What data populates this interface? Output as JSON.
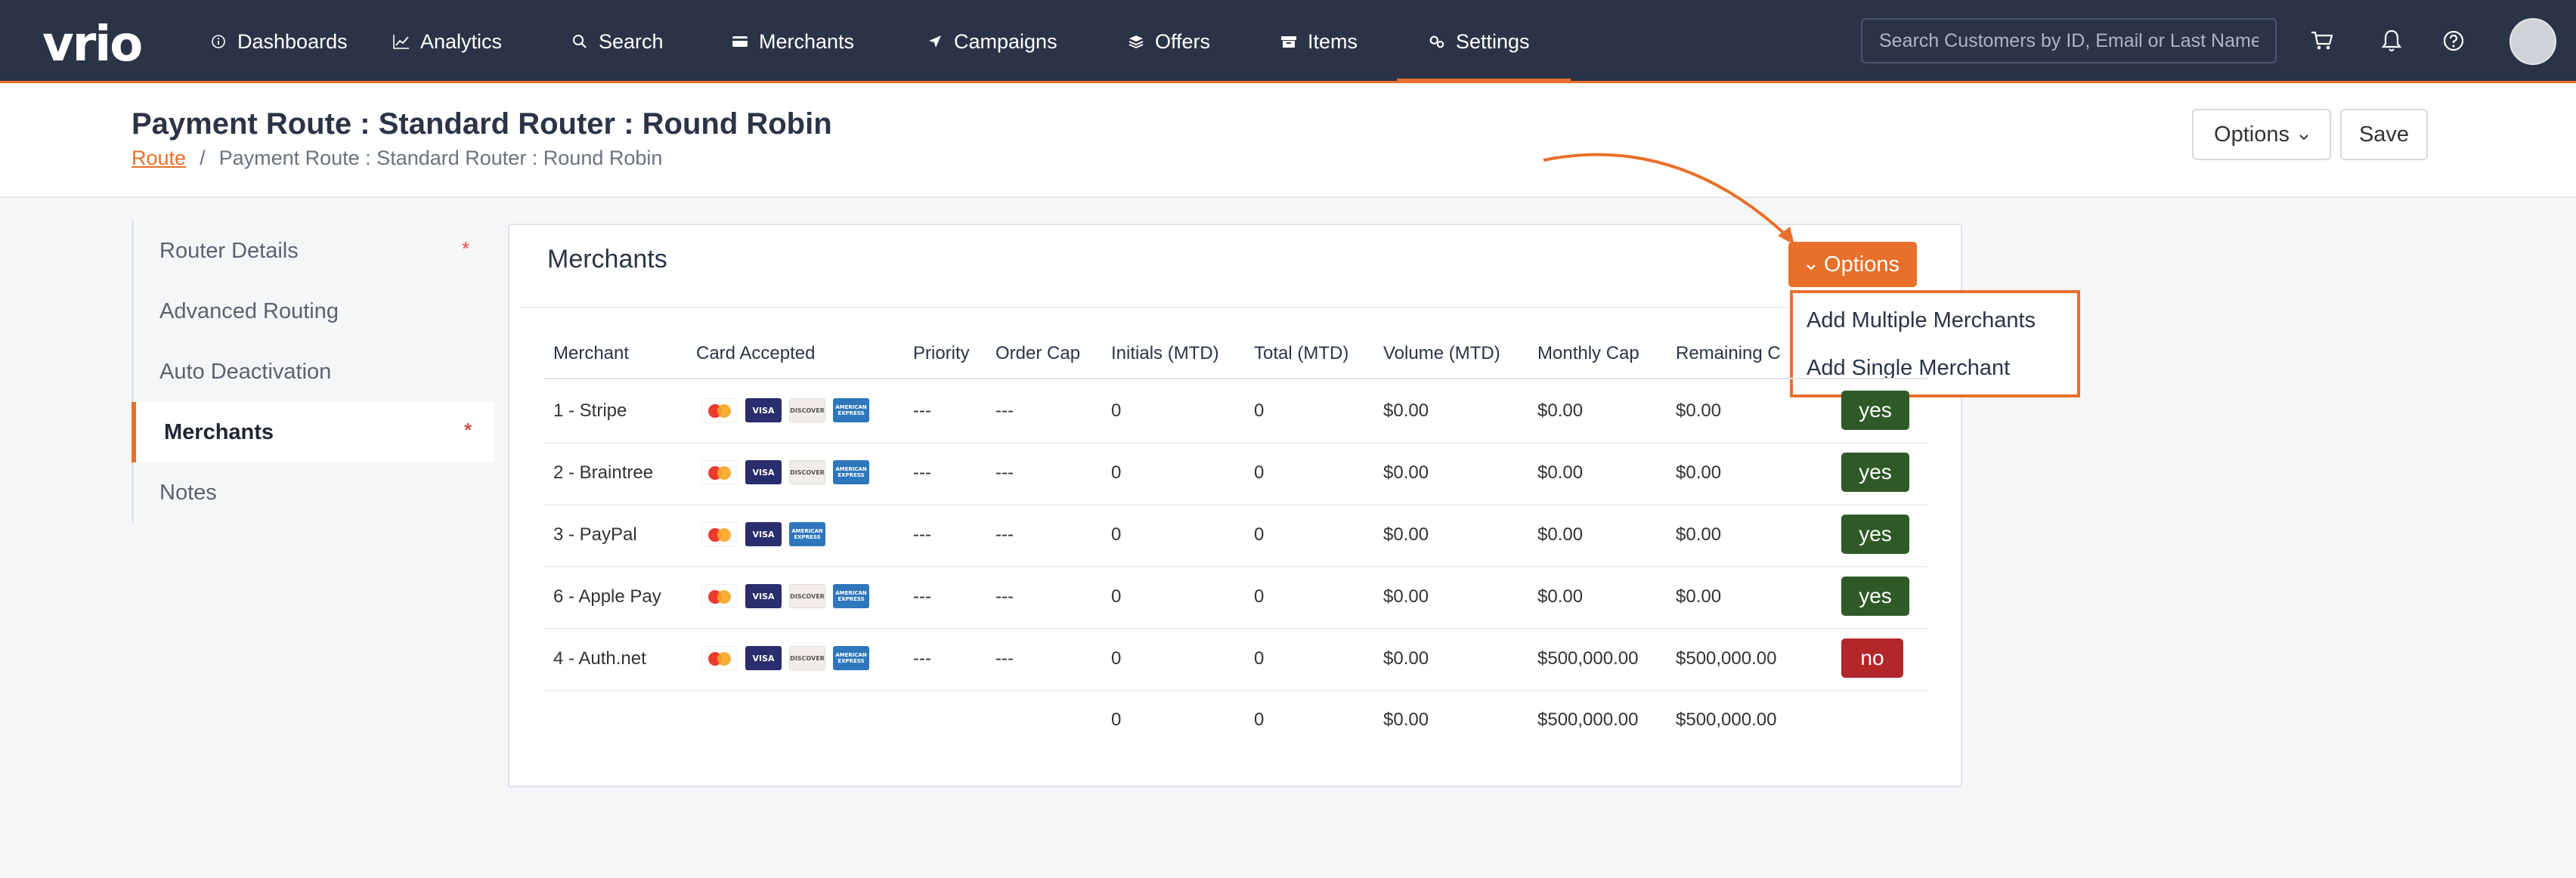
{
  "nav": {
    "logo": "vrio",
    "items": [
      {
        "label": "Dashboards",
        "icon": "info-icon"
      },
      {
        "label": "Analytics",
        "icon": "chart-icon"
      },
      {
        "label": "Search",
        "icon": "search-icon"
      },
      {
        "label": "Merchants",
        "icon": "card-icon"
      },
      {
        "label": "Campaigns",
        "icon": "send-icon"
      },
      {
        "label": "Offers",
        "icon": "layers-icon"
      },
      {
        "label": "Items",
        "icon": "box-icon"
      },
      {
        "label": "Settings",
        "icon": "gears-icon"
      }
    ],
    "active": "Settings",
    "search_placeholder": "Search Customers by ID, Email or Last Name"
  },
  "header": {
    "title": "Payment Route : Standard Router : Round Robin",
    "breadcrumb_link": "Route",
    "breadcrumb_sep": "/",
    "breadcrumb_current": "Payment Route : Standard Router : Round Robin",
    "options_label": "Options",
    "save_label": "Save"
  },
  "sidebar": {
    "items": [
      {
        "label": "Router Details",
        "required": "*"
      },
      {
        "label": "Advanced Routing",
        "required": ""
      },
      {
        "label": "Auto Deactivation",
        "required": ""
      },
      {
        "label": "Merchants",
        "required": "*"
      },
      {
        "label": "Notes",
        "required": ""
      }
    ],
    "active": "Merchants"
  },
  "panel": {
    "title": "Merchants",
    "options_label": "Options",
    "dropdown": [
      "Add Multiple Merchants",
      "Add Single Merchant"
    ]
  },
  "table": {
    "headers": [
      "Merchant",
      "Card Accepted",
      "Priority",
      "Order Cap",
      "Initials (MTD)",
      "Total (MTD)",
      "Volume (MTD)",
      "Monthly Cap",
      "Remaining C"
    ],
    "rows": [
      {
        "merchant": "1 - Stripe",
        "cards": [
          "mastercard",
          "visa",
          "discover",
          "amex"
        ],
        "priority": "---",
        "order_cap": "---",
        "initials": "0",
        "total": "0",
        "volume": "$0.00",
        "monthly_cap": "$0.00",
        "remaining": "$0.00",
        "active": "yes"
      },
      {
        "merchant": "2 - Braintree",
        "cards": [
          "mastercard",
          "visa",
          "discover",
          "amex"
        ],
        "priority": "---",
        "order_cap": "---",
        "initials": "0",
        "total": "0",
        "volume": "$0.00",
        "monthly_cap": "$0.00",
        "remaining": "$0.00",
        "active": "yes"
      },
      {
        "merchant": "3 - PayPal",
        "cards": [
          "mastercard",
          "visa",
          "amex"
        ],
        "priority": "---",
        "order_cap": "---",
        "initials": "0",
        "total": "0",
        "volume": "$0.00",
        "monthly_cap": "$0.00",
        "remaining": "$0.00",
        "active": "yes"
      },
      {
        "merchant": "6 - Apple Pay",
        "cards": [
          "mastercard",
          "visa",
          "discover",
          "amex"
        ],
        "priority": "---",
        "order_cap": "---",
        "initials": "0",
        "total": "0",
        "volume": "$0.00",
        "monthly_cap": "$0.00",
        "remaining": "$0.00",
        "active": "yes"
      },
      {
        "merchant": "4 - Auth.net",
        "cards": [
          "mastercard",
          "visa",
          "discover",
          "amex"
        ],
        "priority": "---",
        "order_cap": "---",
        "initials": "0",
        "total": "0",
        "volume": "$0.00",
        "monthly_cap": "$500,000.00",
        "remaining": "$500,000.00",
        "active": "no"
      }
    ],
    "totals": {
      "initials": "0",
      "total": "0",
      "volume": "$0.00",
      "monthly_cap": "$500,000.00",
      "remaining": "$500,000.00"
    }
  },
  "colors": {
    "accent": "#e8702a",
    "nav_bg": "#2b3447",
    "yes": "#2f5a27",
    "no": "#b3262a"
  }
}
